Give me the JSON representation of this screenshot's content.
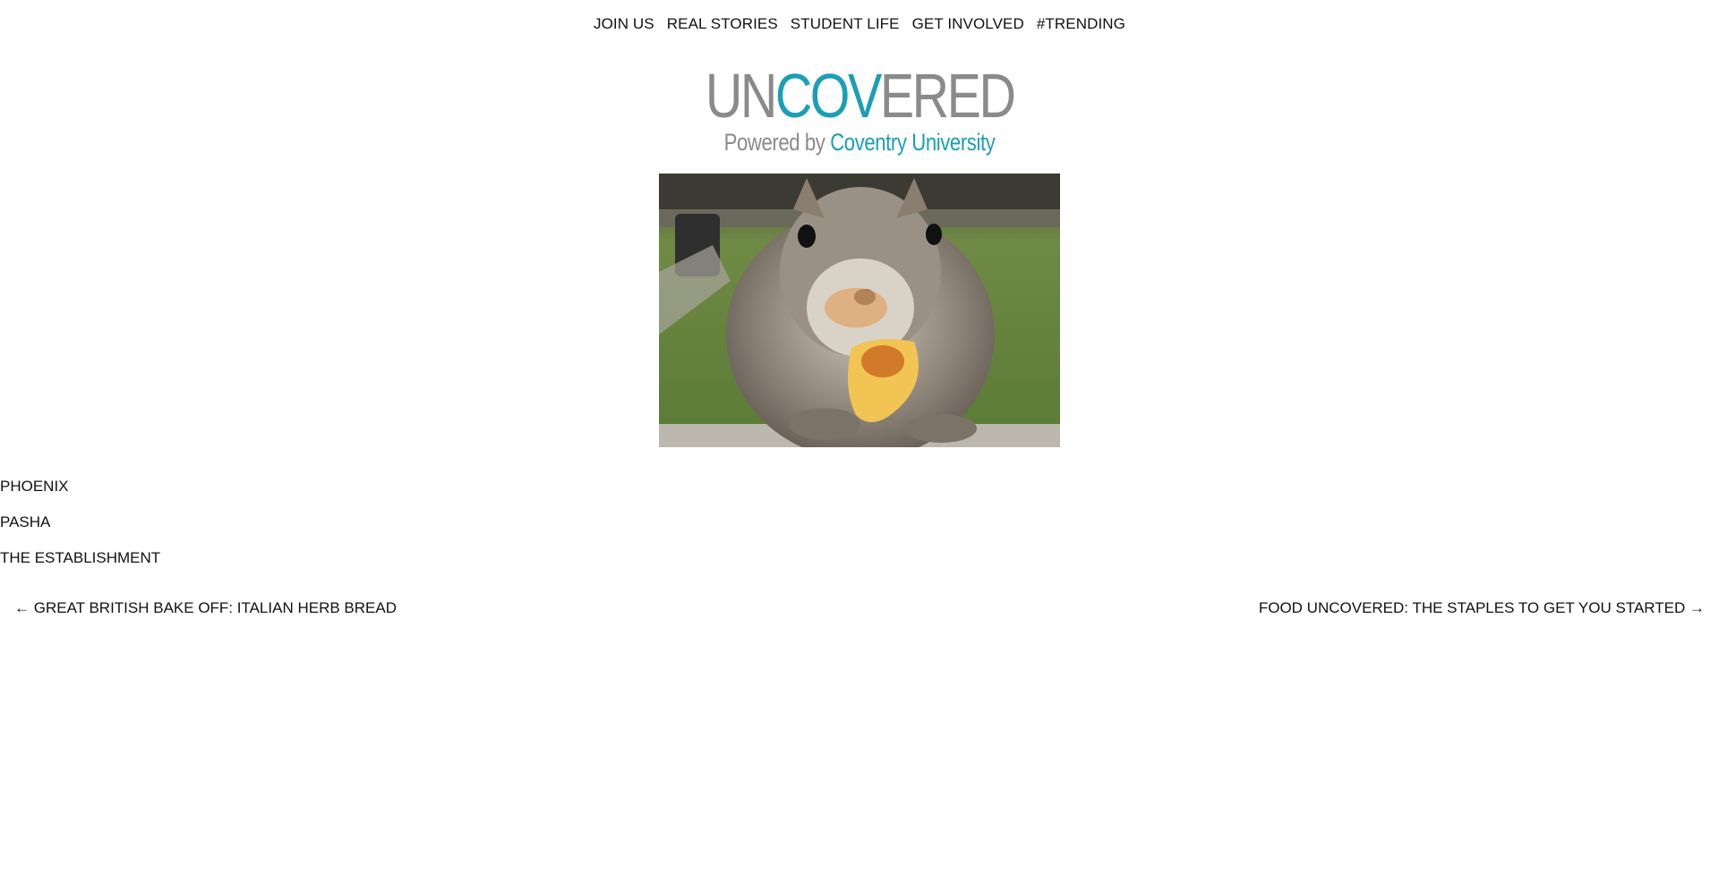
{
  "nav": {
    "items": [
      {
        "label": "JOIN US"
      },
      {
        "label": "REAL STORIES"
      },
      {
        "label": "STUDENT LIFE"
      },
      {
        "label": "GET INVOLVED"
      },
      {
        "label": "#TRENDING"
      }
    ]
  },
  "logo": {
    "part1": "UN",
    "part2": "COV",
    "part3": "ERED",
    "sub_prefix": "Powered by ",
    "sub_brand": "Coventry University"
  },
  "hero_image": {
    "icon": "squirrel-photo"
  },
  "side_links": [
    {
      "label": "PHOENIX"
    },
    {
      "label": "PASHA"
    },
    {
      "label": "THE ESTABLISHMENT"
    }
  ],
  "post_nav": {
    "prev_arrow": "←",
    "prev_label": "GREAT BRITISH BAKE OFF: ITALIAN HERB BREAD",
    "next_label": "FOOD UNCOVERED: THE STAPLES TO GET YOU STARTED",
    "next_arrow": "→"
  },
  "colors": {
    "brand_teal": "#1a9fb5",
    "brand_grey": "#8a8a8a"
  }
}
